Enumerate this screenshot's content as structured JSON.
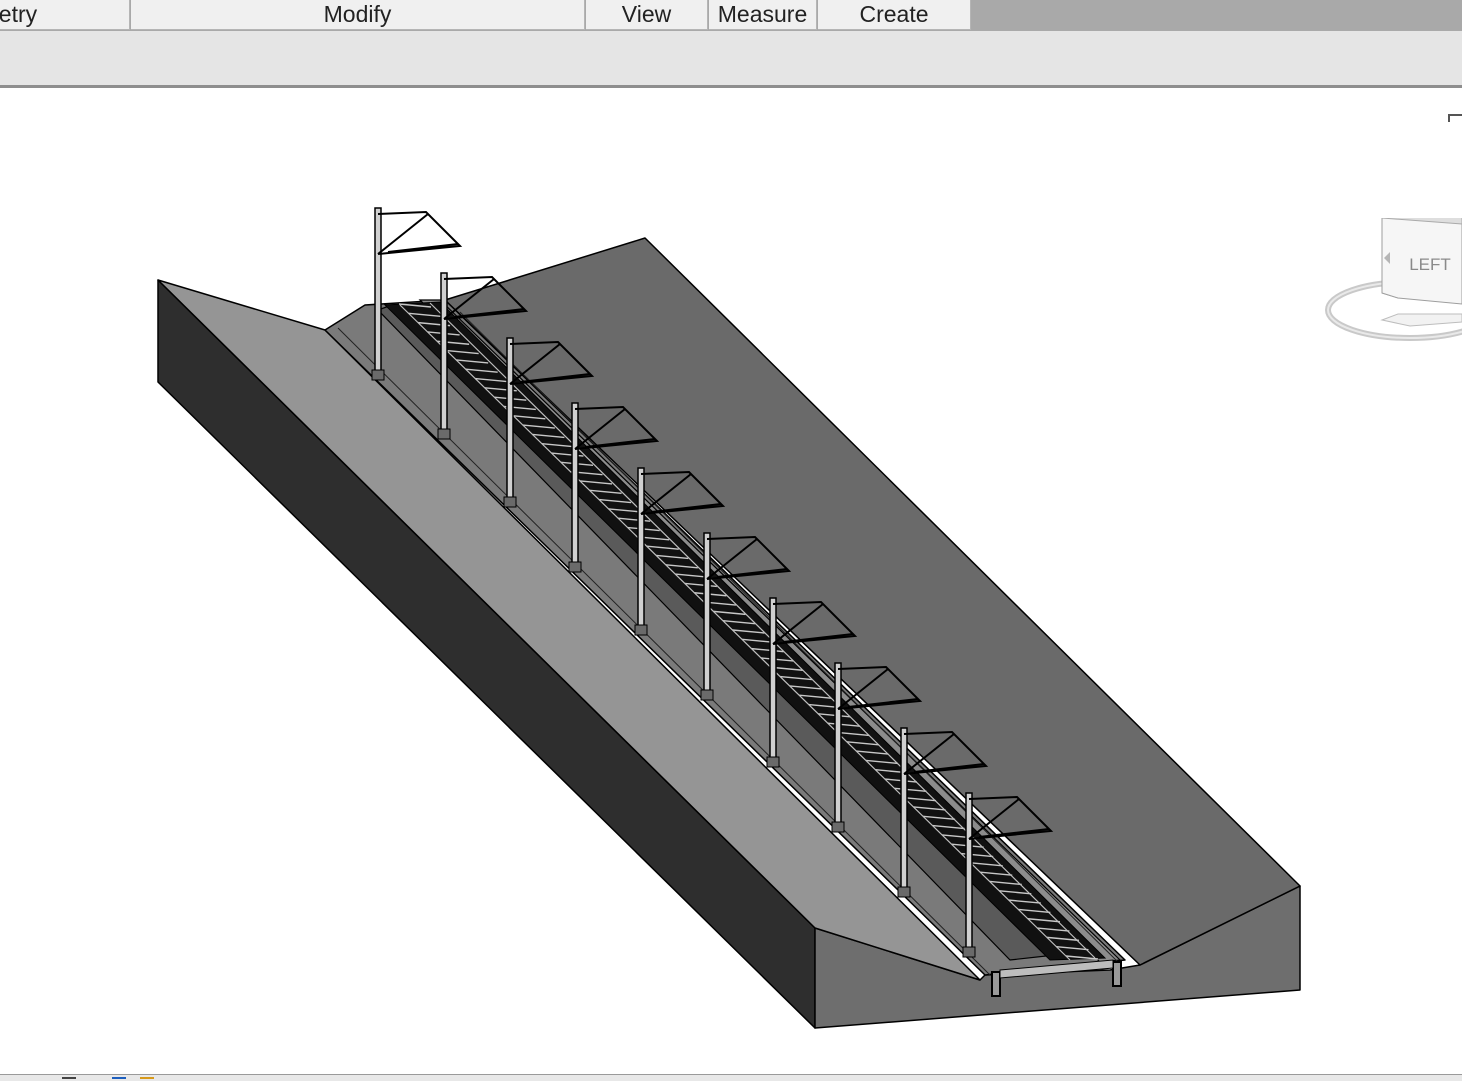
{
  "ribbon": {
    "tabs": [
      {
        "label": "netry"
      },
      {
        "label": "Modify"
      },
      {
        "label": "View"
      },
      {
        "label": "Measure"
      },
      {
        "label": "Create"
      }
    ]
  },
  "viewcube": {
    "face_label": "LEFT"
  },
  "colors": {
    "tab_background": "#f0f0f0",
    "ribbon_background": "#e5e5e5",
    "viewport_background": "#ffffff",
    "embankment_side_dark": "#2e2e2e",
    "embankment_slope_light": "#959595",
    "embankment_slope_far": "#6a6a6a",
    "track_bed": "#111111"
  },
  "icons": [
    "viewcube-icon",
    "viewport-control-icon",
    "catenary-mast-icon"
  ]
}
